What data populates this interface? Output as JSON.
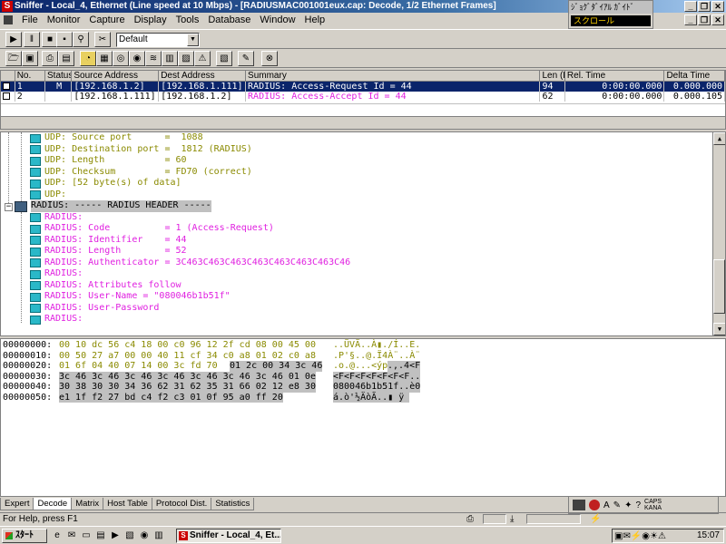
{
  "window": {
    "title": "Sniffer - Local_4, Ethernet (Line speed at 10 Mbps) - [RADIUSMAC001001eux.cap: Decode, 1/2 Ethernet Frames]",
    "app_icon": "S"
  },
  "jp_panel": {
    "title": "ｼﾞｮｸﾞﾀﾞｲｱﾙ ｶﾞｲﾄﾞ",
    "value": "スクロール"
  },
  "menu": [
    "File",
    "Monitor",
    "Capture",
    "Display",
    "Tools",
    "Database",
    "Window",
    "Help"
  ],
  "toolbar": {
    "profile_select": "Default"
  },
  "packet_list": {
    "columns": [
      "No.",
      "Status",
      "Source Address",
      "Dest Address",
      "Summary",
      "Len (B",
      "Rel. Time",
      "Delta Time"
    ],
    "rows": [
      {
        "no": "1",
        "status": "M",
        "src": "[192.168.1.2]",
        "dst": "[192.168.1.111]",
        "summary": "RADIUS: Access-Request Id = 44",
        "len": "94",
        "rel": "0:00:00.000",
        "delta": "0.000.000"
      },
      {
        "no": "2",
        "status": "",
        "src": "[192.168.1.111]",
        "dst": "[192.168.1.2]",
        "summary": "RADIUS: Access-Accept Id = 44",
        "len": "62",
        "rel": "0:00:00.000",
        "delta": "0.000.105"
      }
    ]
  },
  "decode": {
    "udp_lines": [
      "UDP: Source port      =  1088",
      "UDP: Destination port =  1812 (RADIUS)",
      "UDP: Length           = 60",
      "UDP: Checksum         = FD70 (correct)",
      "UDP: [52 byte(s) of data]",
      "UDP:"
    ],
    "radius_header": "RADIUS: ----- RADIUS HEADER -----",
    "radius_lines": [
      "RADIUS:",
      "RADIUS: Code          = 1 (Access-Request)",
      "RADIUS: Identifier    = 44",
      "RADIUS: Length        = 52",
      "RADIUS: Authenticator = 3C463C463C463C463C463C463C463C46",
      "RADIUS:",
      "RADIUS: Attributes follow",
      "RADIUS: User-Name = \"080046b1b51f\"",
      "RADIUS: User-Password",
      "RADIUS:"
    ]
  },
  "hex": {
    "lines": [
      {
        "offset": "00000000:",
        "pre": "00 10 dc 56 c4 18 00 c0 96 12 2f cd 08 00 45 00",
        "sel": "",
        "ascii_pre": "..ÜVÄ..À▮./Í..E.",
        "ascii_sel": ""
      },
      {
        "offset": "00000010:",
        "pre": "00 50 27 a7 00 00 40 11 cf 34 c0 a8 01 02 c0 a8",
        "sel": "",
        "ascii_pre": ".P'§..@.Ï4À¨..À¨",
        "ascii_sel": ""
      },
      {
        "offset": "00000020:",
        "pre": "01 6f 04 40 07 14 00 3c fd 70 ",
        "sel": "01 2c 00 34 3c 46",
        "ascii_pre": ".o.@...<ýp",
        "ascii_sel": ".,.4<F"
      },
      {
        "offset": "00000030:",
        "pre": "",
        "sel": "3c 46 3c 46 3c 46 3c 46 3c 46 3c 46 3c 46 01 0e",
        "ascii_pre": "",
        "ascii_sel": "<F<F<F<F<F<F<F.."
      },
      {
        "offset": "00000040:",
        "pre": "",
        "sel": "30 38 30 30 34 36 62 31 62 35 31 66 02 12 e8 30",
        "ascii_pre": "",
        "ascii_sel": "080046b1b51f..è0"
      },
      {
        "offset": "00000050:",
        "pre": "",
        "sel": "e1 1f f2 27 bd c4 f2 c3 01 0f 95 a0 ff 20",
        "ascii_pre": "",
        "ascii_sel": "á.ò'½ÄòÃ..▮ ÿ "
      }
    ]
  },
  "tabs": [
    "Expert",
    "Decode",
    "Matrix",
    "Host Table",
    "Protocol Dist.",
    "Statistics"
  ],
  "active_tab": "Decode",
  "ime": {
    "caps": "CAPS",
    "kana": "KANA"
  },
  "status": {
    "help": "For Help, press F1"
  },
  "taskbar": {
    "start": "ｽﾀｰﾄ",
    "task": "Sniffer - Local_4, Et...",
    "clock": "15:07"
  }
}
